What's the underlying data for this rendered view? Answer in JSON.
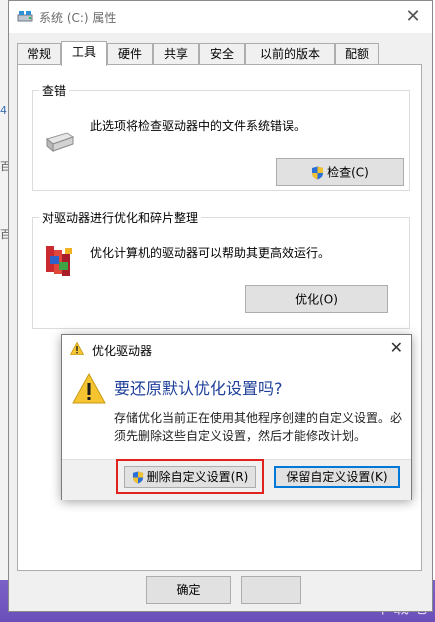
{
  "window": {
    "title": "系统 (C:) 属性",
    "close_symbol": "✕"
  },
  "tabs": [
    {
      "label": "常规"
    },
    {
      "label": "工具",
      "active": true
    },
    {
      "label": "硬件"
    },
    {
      "label": "共享"
    },
    {
      "label": "安全"
    },
    {
      "label": "以前的版本"
    },
    {
      "label": "配额"
    }
  ],
  "check_section": {
    "title": "查错",
    "description": "此选项将检查驱动器中的文件系统错误。",
    "button_label": "检查(C)",
    "icon": "drive-icon"
  },
  "optimize_section": {
    "title": "对驱动器进行优化和碎片整理",
    "description": "优化计算机的驱动器可以帮助其更高效运行。",
    "button_label": "优化(O)",
    "icon": "defrag-icon"
  },
  "bottom_buttons": {
    "ok_label": "确定"
  },
  "dialog": {
    "title": "优化驱动器",
    "close_symbol": "✕",
    "heading": "要还原默认优化设置吗?",
    "message": "存储优化当前正在使用其他程序创建的自定义设置。必须先删除这些自定义设置，然后才能修改计划。",
    "delete_button_label": "删除自定义设置(R)",
    "keep_button_label": "保留自定义设置(K)",
    "highlight_color": "#e0221f",
    "heading_color": "#1e3f9a"
  },
  "background": {
    "side_chars": [
      "4",
      "百",
      "百"
    ],
    "watermark": "下载吧"
  }
}
